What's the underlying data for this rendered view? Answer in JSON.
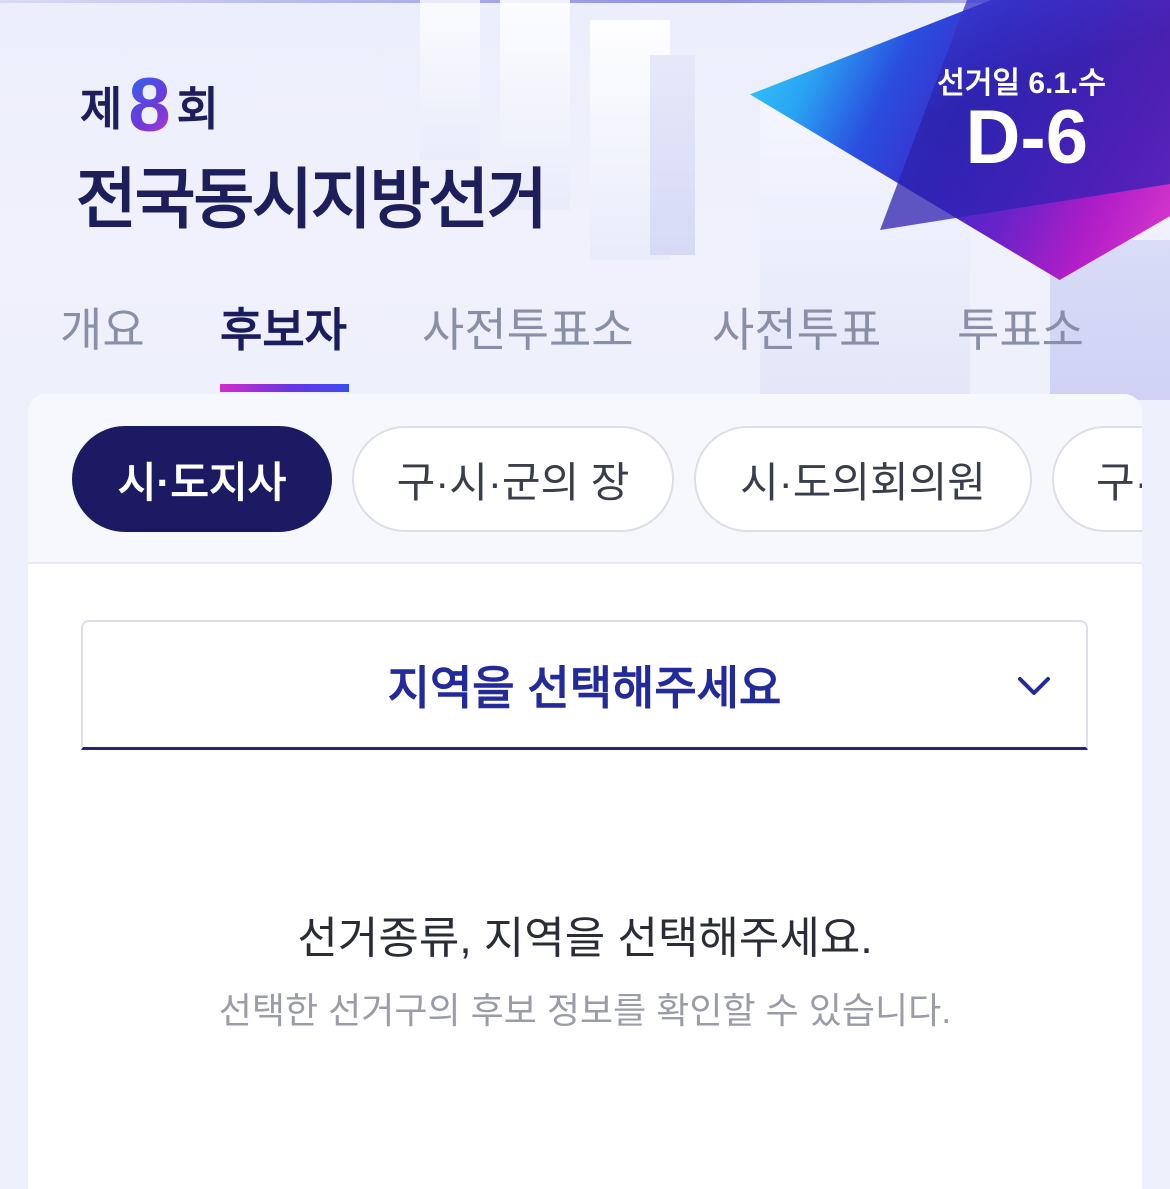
{
  "header": {
    "title_prefix": "제",
    "title_number": "8",
    "title_suffix": "회",
    "title_main": "전국동시지방선거",
    "election_day_label": "선거일 6.1.수",
    "dday": "D-6"
  },
  "tabs": [
    {
      "label": "개요"
    },
    {
      "label": "후보자"
    },
    {
      "label": "사전투표소"
    },
    {
      "label": "사전투표"
    },
    {
      "label": "투표소"
    }
  ],
  "active_tab": "후보자",
  "election_types": [
    {
      "label": "시·도지사"
    },
    {
      "label": "구·시·군의 장"
    },
    {
      "label": "시·도의회의원"
    },
    {
      "label": "구·시"
    }
  ],
  "active_election_type": "시·도지사",
  "region_select": {
    "label": "지역을 선택해주세요"
  },
  "empty_state": {
    "title": "선거종류, 지역을 선택해주세요.",
    "subtitle": "선택한 선거구의 후보 정보를 확인할 수 있습니다."
  },
  "colors": {
    "navy": "#1c1a63",
    "accent_blue": "#232a9a",
    "tab_gradient_start": "#d22ec8",
    "tab_gradient_end": "#3a4ef0"
  }
}
